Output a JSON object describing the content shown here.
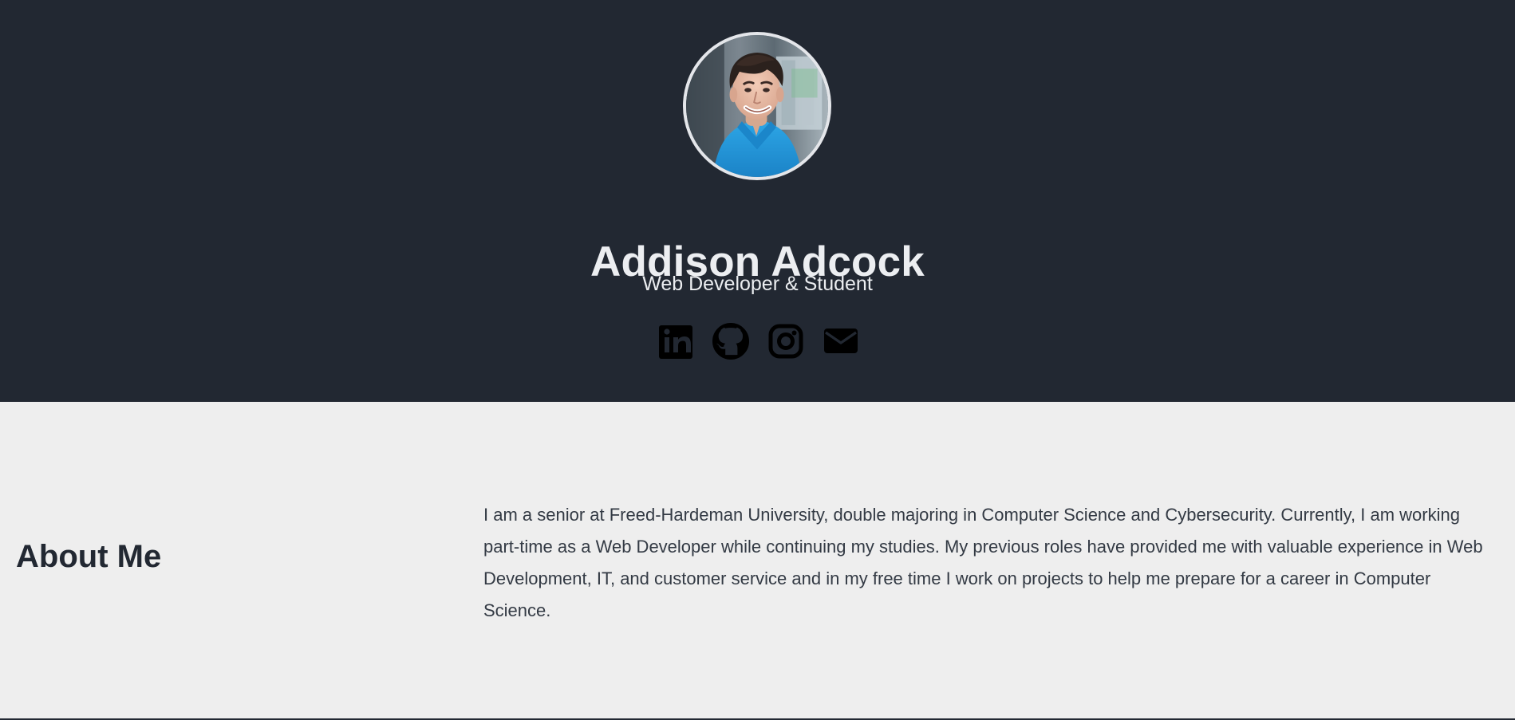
{
  "hero": {
    "name": "Addison Adcock",
    "subtitle": "Web Developer & Student",
    "avatar_alt": "Profile photo of Addison Adcock",
    "social_links": [
      {
        "label": "LinkedIn",
        "icon": "linkedin-icon"
      },
      {
        "label": "GitHub",
        "icon": "github-icon"
      },
      {
        "label": "Instagram",
        "icon": "instagram-icon"
      },
      {
        "label": "Email",
        "icon": "envelope-icon"
      }
    ]
  },
  "about": {
    "title": "About Me",
    "body": "I am a senior at Freed-Hardeman University, double majoring in Computer Science and Cybersecurity. Currently, I am working part-time as a Web Developer while continuing my studies. My previous roles have provided me with valuable experience in Web Development, IT, and customer service and in my free time I work on projects to help me prepare for a career in Computer Science."
  },
  "colors": {
    "hero_background": "#222832",
    "about_background": "#eeeeee",
    "text_light": "#eceef1",
    "text_dark": "#222832",
    "body_text": "#333a44"
  }
}
